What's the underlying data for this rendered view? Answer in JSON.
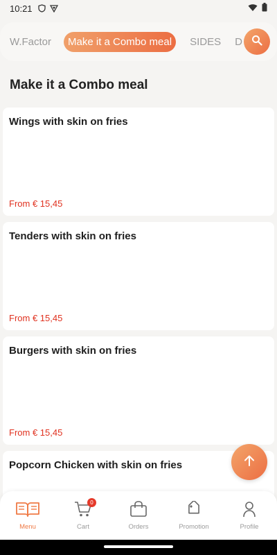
{
  "status_bar": {
    "time": "10:21"
  },
  "categories": {
    "tabs": [
      {
        "label": "W.Factor",
        "active": false
      },
      {
        "label": "Make it a Combo meal",
        "active": true
      },
      {
        "label": "SIDES",
        "active": false
      },
      {
        "label": "D",
        "active": false
      }
    ],
    "search_icon": "search-icon"
  },
  "section": {
    "title": "Make it a Combo meal"
  },
  "products": [
    {
      "title": "Wings with skin on fries",
      "price": "From € 15,45"
    },
    {
      "title": "Tenders with skin on fries",
      "price": "From € 15,45"
    },
    {
      "title": "Burgers with skin on fries",
      "price": "From € 15,45"
    },
    {
      "title": "Popcorn Chicken with skin on fries",
      "price": ""
    }
  ],
  "fab": {
    "icon": "arrow-up-icon"
  },
  "bottom_nav": {
    "items": [
      {
        "label": "Menu",
        "icon": "book-icon",
        "active": true
      },
      {
        "label": "Cart",
        "icon": "cart-icon",
        "badge": "0"
      },
      {
        "label": "Orders",
        "icon": "bag-icon"
      },
      {
        "label": "Promotion",
        "icon": "tag-icon"
      },
      {
        "label": "Profile",
        "icon": "person-icon"
      }
    ]
  },
  "colors": {
    "accent": "#ec6e43",
    "price": "#e0311f",
    "badge": "#e53a2a"
  }
}
